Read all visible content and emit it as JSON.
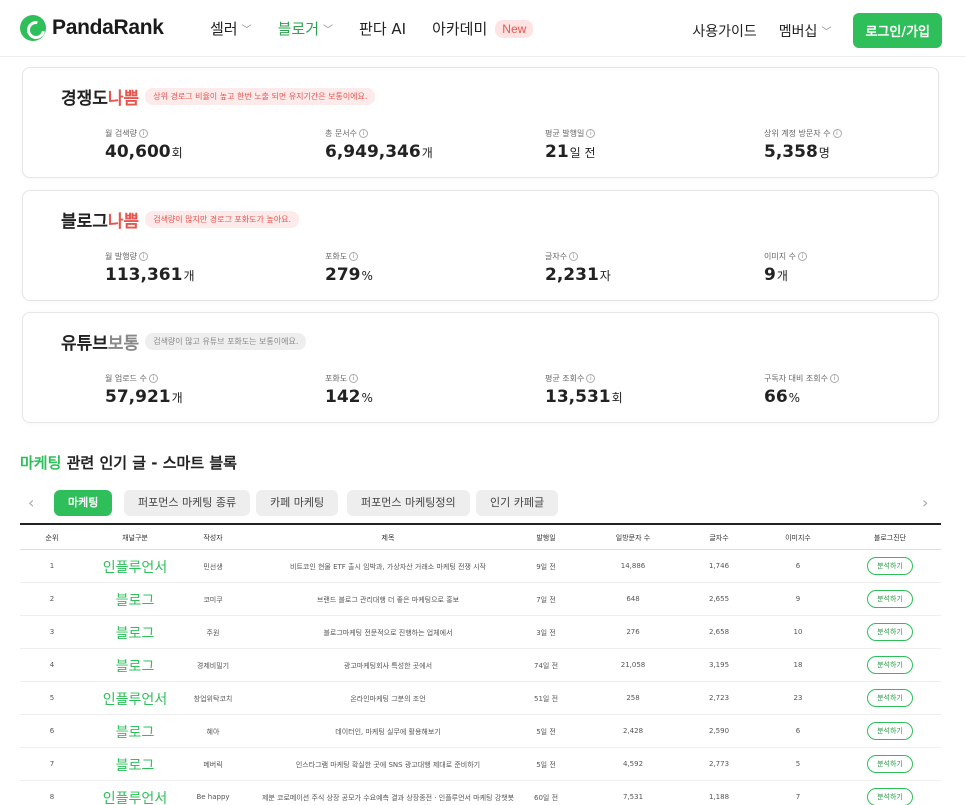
{
  "header": {
    "logo": "PandaRank",
    "nav": [
      {
        "label": "셀러",
        "dropdown": true,
        "active": false
      },
      {
        "label": "블로거",
        "dropdown": true,
        "active": true
      },
      {
        "label": "판다 AI",
        "dropdown": false,
        "active": false
      },
      {
        "label": "아카데미",
        "dropdown": false,
        "active": false,
        "badge": "New"
      }
    ],
    "guide": "사용가이드",
    "membership": "멤버십",
    "login": "로그인/가입"
  },
  "cards": [
    {
      "title": "경쟁도",
      "grade": "나쁨",
      "grade_color": "#e8554e",
      "note": "상위 경로그 비율이 높고 한번 노출 되면 유지기간은 보통이에요.",
      "metrics": [
        {
          "label": "월 검색량",
          "value": "40,600",
          "unit": "회"
        },
        {
          "label": "총 문서수",
          "value": "6,949,346",
          "unit": "개"
        },
        {
          "label": "평균 발행일",
          "value": "21",
          "unit": "일 전"
        },
        {
          "label": "상위 계정 방문자 수",
          "value": "5,358",
          "unit": "명"
        }
      ]
    },
    {
      "title": "블로그",
      "grade": "나쁨",
      "grade_color": "#e8554e",
      "note": "검색량이 많지만 경로그 포화도가 높아요.",
      "metrics": [
        {
          "label": "월 발행량",
          "value": "113,361",
          "unit": "개"
        },
        {
          "label": "포화도",
          "value": "279",
          "unit": "%"
        },
        {
          "label": "글자수",
          "value": "2,231",
          "unit": "자"
        },
        {
          "label": "이미지 수",
          "value": "9",
          "unit": "개"
        }
      ]
    },
    {
      "title": "유튜브",
      "grade": "보통",
      "grade_color": "#888888",
      "note": "검색량이 많고 유튜브 포화도는 보통이에요.",
      "metrics": [
        {
          "label": "월 업로드 수",
          "value": "57,921",
          "unit": "개"
        },
        {
          "label": "포화도",
          "value": "142",
          "unit": "%"
        },
        {
          "label": "평균 조회수",
          "value": "13,531",
          "unit": "회"
        },
        {
          "label": "구독자 대비 조회수",
          "value": "66",
          "unit": "%"
        }
      ]
    }
  ],
  "section": {
    "keyword": "마케팅",
    "title_rest": " 관련 인기 글 - 스마트 블록"
  },
  "chips": [
    "마케팅",
    "퍼포먼스 마케팅 종류",
    "카페 마케팅",
    "퍼포먼스 마케팅정의",
    "인기 카페글"
  ],
  "table": {
    "headers": [
      "순위",
      "채널구분",
      "작성자",
      "제목",
      "발행일",
      "일방문자 수",
      "글자수",
      "이미지수",
      "블로그진단"
    ],
    "analyze_label": "분석하기",
    "rows": [
      [
        "1",
        "인플루언서",
        "민선생",
        "비트코인 현물 ETF 출시 임박과, 가상자산 거래소 마케팅 전쟁 시작",
        "9일 전",
        "14,886",
        "1,746",
        "6"
      ],
      [
        "2",
        "블로그",
        "코미쿠",
        "브랜드 블로그 관리대행 더 좋은 마케팅으로 홍보",
        "7일 전",
        "648",
        "2,655",
        "9"
      ],
      [
        "3",
        "블로그",
        "주원",
        "블로그마케팅 전문적으로 진행하는 업체에서",
        "3일 전",
        "276",
        "2,658",
        "10"
      ],
      [
        "4",
        "블로그",
        "경제비밀기",
        "광고마케팅회사 특성한 곳에서",
        "74일 전",
        "21,058",
        "3,195",
        "18"
      ],
      [
        "5",
        "인플루언서",
        "창업위탁코치",
        "온라인마케팅 그분의 조언",
        "51일 전",
        "258",
        "2,723",
        "23"
      ],
      [
        "6",
        "블로그",
        "혜아",
        "데이터인, 마케팅 실무에 활용해보기",
        "5일 전",
        "2,428",
        "2,590",
        "6"
      ],
      [
        "7",
        "블로그",
        "메버릭",
        "인스타그램 마케팅 확실한 곳에 SNS 광고대행 제대로 준비하기",
        "5일 전",
        "4,592",
        "2,773",
        "5"
      ],
      [
        "8",
        "인플루언서",
        "Be happy",
        "제분 코로메이션 주식 상장 공모가 수요예측 결과 상장종전 · 인플루언서 마케팅 강챗봇",
        "60일 전",
        "7,531",
        "1,188",
        "7"
      ]
    ]
  }
}
